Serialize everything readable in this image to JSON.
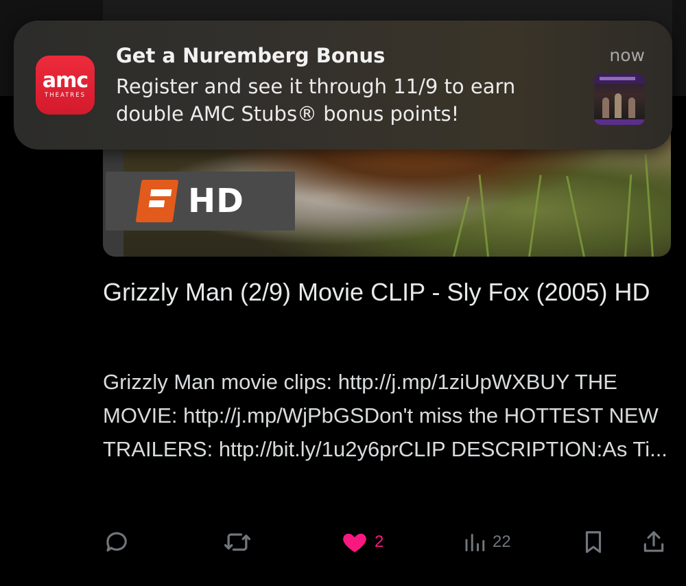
{
  "notification": {
    "app_icon": {
      "brand": "amc",
      "subtitle": "THEATRES",
      "color": "#e3202f"
    },
    "title": "Get a Nuremberg Bonus",
    "body": "Register and see it through 11/9 to earn double AMC Stubs® bonus points!",
    "time": "now",
    "attachment": "nuremberg-promo-thumbnail"
  },
  "video": {
    "badge_text": "HD",
    "badge_logo": "fandango-f-logo",
    "title": "Grizzly Man (2/9) Movie CLIP - Sly Fox (2005) HD",
    "description": "Grizzly Man movie clips: http://j.mp/1ziUpWXBUY THE MOVIE: http://j.mp/WjPbGSDon't miss the HOTTEST NEW TRAILERS: http://bit.ly/1u2y6prCLIP DESCRIPTION:As Ti..."
  },
  "actions": {
    "reply": {
      "icon": "reply-icon",
      "count": ""
    },
    "repost": {
      "icon": "repost-icon",
      "count": ""
    },
    "like": {
      "icon": "heart-filled-icon",
      "count": "2",
      "color": "#f91880"
    },
    "views": {
      "icon": "views-icon",
      "count": "22"
    },
    "bookmark": {
      "icon": "bookmark-icon"
    },
    "share": {
      "icon": "share-icon"
    }
  }
}
